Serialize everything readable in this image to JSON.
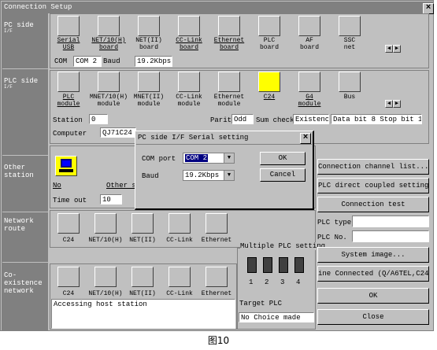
{
  "window": {
    "title": "Connection Setup",
    "close_symbol": "×"
  },
  "sidebar": {
    "pc_side": [
      "PC side",
      "I/F"
    ],
    "plc_side": [
      "PLC side",
      "I/F"
    ],
    "other_station": [
      "Other",
      "station"
    ],
    "network_route": [
      "Network",
      "route"
    ],
    "coexistence_network": [
      "Co-existence",
      "network"
    ]
  },
  "pc_side": {
    "items": [
      {
        "label": [
          "Serial",
          "USB"
        ],
        "underlined": true
      },
      {
        "label": [
          "NET/10(H)",
          "board"
        ],
        "underlined": true
      },
      {
        "label": [
          "NET(II)",
          "board"
        ],
        "underlined": false
      },
      {
        "label": [
          "CC-Link",
          "board"
        ],
        "underlined": true
      },
      {
        "label": [
          "Ethernet",
          "board"
        ],
        "underlined": true
      },
      {
        "label": [
          "PLC",
          "board"
        ],
        "underlined": false
      },
      {
        "label": [
          "AF",
          "board"
        ],
        "underlined": false
      },
      {
        "label": [
          "SSC",
          "net"
        ],
        "underlined": false
      }
    ],
    "com_label": "COM",
    "com_value": "COM 2",
    "baud_label": "Baud",
    "baud_value": "19.2Kbps"
  },
  "plc_side": {
    "items": [
      {
        "label": [
          "PLC",
          "module"
        ],
        "underlined": true
      },
      {
        "label": [
          "MNET/10(H)",
          "module"
        ],
        "underlined": false
      },
      {
        "label": [
          "MNET(II)",
          "module"
        ],
        "underlined": false
      },
      {
        "label": [
          "CC-Link",
          "module"
        ],
        "underlined": false
      },
      {
        "label": [
          "Ethernet",
          "module"
        ],
        "underlined": false
      },
      {
        "label": [
          "C24",
          ""
        ],
        "underlined": true
      },
      {
        "label": [
          "G4",
          "module"
        ],
        "underlined": true
      },
      {
        "label": [
          "Bus",
          ""
        ],
        "underlined": false
      }
    ],
    "station_label": "Station",
    "station_value": "0",
    "parity_label": "Parit",
    "parity_value": "Odd",
    "sum_check_label": "Sum check",
    "sum_check_value": "Existenc",
    "data_bit_stop_bit": "Data bit 8  Stop bit 1",
    "computer_label": "Computer",
    "computer_value": "QJ71C24"
  },
  "other_station": {
    "item_label": "No",
    "other_label": "Other s",
    "timeout_label": "Time out",
    "timeout_value": "10"
  },
  "network_route": {
    "items": [
      "C24",
      "NET/10(H)",
      "NET(II)",
      "CC-Link",
      "Ethernet"
    ]
  },
  "coexistence_network": {
    "items": [
      "C24",
      "NET/10(H)",
      "NET(II)",
      "CC-Link",
      "Ethernet"
    ],
    "status_text": "Accessing host station"
  },
  "multiple_plc": {
    "title": "Multiple PLC setting",
    "numbers": [
      "1",
      "2",
      "3",
      "4"
    ],
    "target_label": "Target PLC",
    "target_value": "No Choice made"
  },
  "right_panel": {
    "channel_list": "Connection  channel  list...",
    "direct_coupled": "PLC direct coupled setting",
    "connection_test": "Connection test",
    "plc_type_label": "PLC type",
    "plc_no_label": "PLC No.",
    "system_image": "System   image...",
    "line_connected": "ine Connected (Q/A6TEL,C24)...",
    "ok": "OK",
    "close": "Close"
  },
  "dialog": {
    "title": "PC side I/F  Serial setting",
    "com_port_label": "COM port",
    "com_port_value": "COM 2",
    "baud_label": "Baud",
    "baud_value": "19.2Kbps",
    "ok": "OK",
    "cancel": "Cancel",
    "close_symbol": "×"
  },
  "caption": "图10",
  "colors": {
    "title_bar": "#808080",
    "sidebar": "#808080",
    "face": "#c0c0c0",
    "selected_icon": "#ffff00",
    "selection": "#000080"
  },
  "icons": {
    "dropdown": "▼",
    "scroll_left": "◀",
    "scroll_right": "▶"
  }
}
